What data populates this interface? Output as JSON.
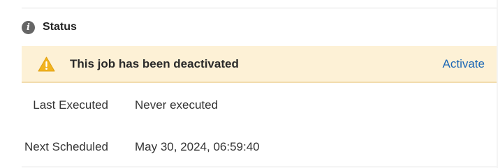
{
  "status_section": {
    "title": "Status",
    "icon": "info-icon"
  },
  "banner": {
    "icon": "warning-icon",
    "message": "This job has been deactivated",
    "action_label": "Activate",
    "colors": {
      "background": "#fdf1d6",
      "warning": "#f2b31f",
      "link": "#1a66b5"
    }
  },
  "details": {
    "last_executed": {
      "label": "Last Executed",
      "value": "Never executed"
    },
    "next_scheduled": {
      "label": "Next Scheduled",
      "value": "May 30, 2024, 06:59:40"
    }
  }
}
